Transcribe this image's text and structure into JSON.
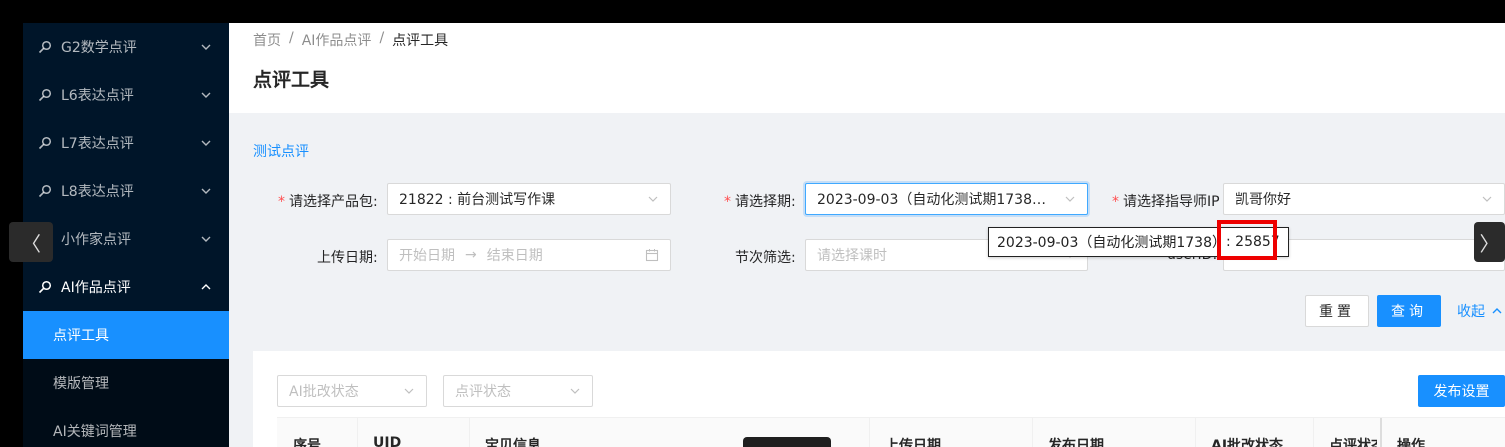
{
  "sidebar": {
    "items": [
      {
        "label": "G2数学点评"
      },
      {
        "label": "L6表达点评"
      },
      {
        "label": "L7表达点评"
      },
      {
        "label": "L8表达点评"
      },
      {
        "label": "小作家点评"
      },
      {
        "label": "AI作品点评"
      }
    ],
    "subitems": [
      {
        "label": "点评工具"
      },
      {
        "label": "模版管理"
      },
      {
        "label": "AI关键词管理"
      }
    ]
  },
  "breadcrumb": {
    "home": "首页",
    "sep": "/",
    "parent": "AI作品点评",
    "current": "点评工具"
  },
  "page_title": "点评工具",
  "card": {
    "link": "测试点评"
  },
  "form": {
    "product_label": "请选择产品包",
    "product_value": "21822 : 前台测试写作课",
    "period_label": "请选择期",
    "period_value": "2023-09-03（自动化测试期1738） : ...",
    "teacher_label": "请选择指导师IP",
    "teacher_value": "凯哥你好",
    "upload_label": "上传日期",
    "start_placeholder": "开始日期",
    "range_arrow": "→",
    "end_placeholder": "结束日期",
    "lesson_label": "节次筛选",
    "lesson_placeholder": "请选择课时",
    "userid_label": "userID",
    "colon": ":"
  },
  "tooltip": {
    "prefix": "2023-09-03（自动化测试期1738）",
    "suffix": ": 25857"
  },
  "buttons": {
    "reset": "重置",
    "query": "查询",
    "collapse": "收起",
    "publish": "发布设置"
  },
  "filters": {
    "ai_status": "AI批改状态",
    "review_status": "点评状态"
  },
  "table": {
    "headers": [
      "序号",
      "UID",
      "宝贝信息",
      "上传日期",
      "发布日期",
      "AI批改状态",
      "点评状态",
      "操作"
    ]
  },
  "nav": {
    "prev": "〈",
    "next": "〉"
  }
}
